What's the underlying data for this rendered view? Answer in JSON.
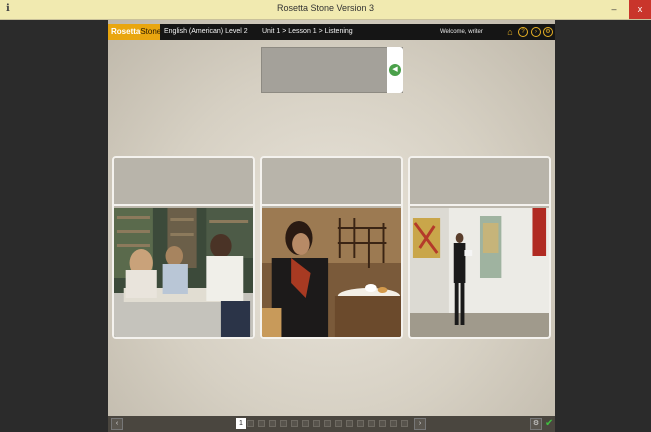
{
  "window": {
    "title": "Rosetta Stone Version 3",
    "app_icon": "rosetta-icon",
    "min_label": "–",
    "max_label": "□",
    "close_label": "x"
  },
  "topbar": {
    "logo_bold": "Rosetta",
    "logo_light": "Stone",
    "course": "English (American) Level 2",
    "breadcrumb": "Unit 1 > Lesson 1 > Listening",
    "welcome": "Welcome, writer",
    "icons": [
      "home-icon",
      "help-icon",
      "exit-icon",
      "settings-icon"
    ]
  },
  "prompt": {
    "speaker_icon": "speaker-icon"
  },
  "cards": [
    {
      "scene": "students studying at a library table"
    },
    {
      "scene": "woman reading a menu at a cafe table"
    },
    {
      "scene": "man looking at paintings in a gallery"
    }
  ],
  "bottombar": {
    "prev_icon": "prev-icon",
    "next_icon": "next-icon",
    "screen_count": 16,
    "current_screen": "1",
    "colors": {
      "accent": "#e9a60f",
      "check_green": "#3fbf3f",
      "check_yellow": "#e9c20f"
    }
  }
}
